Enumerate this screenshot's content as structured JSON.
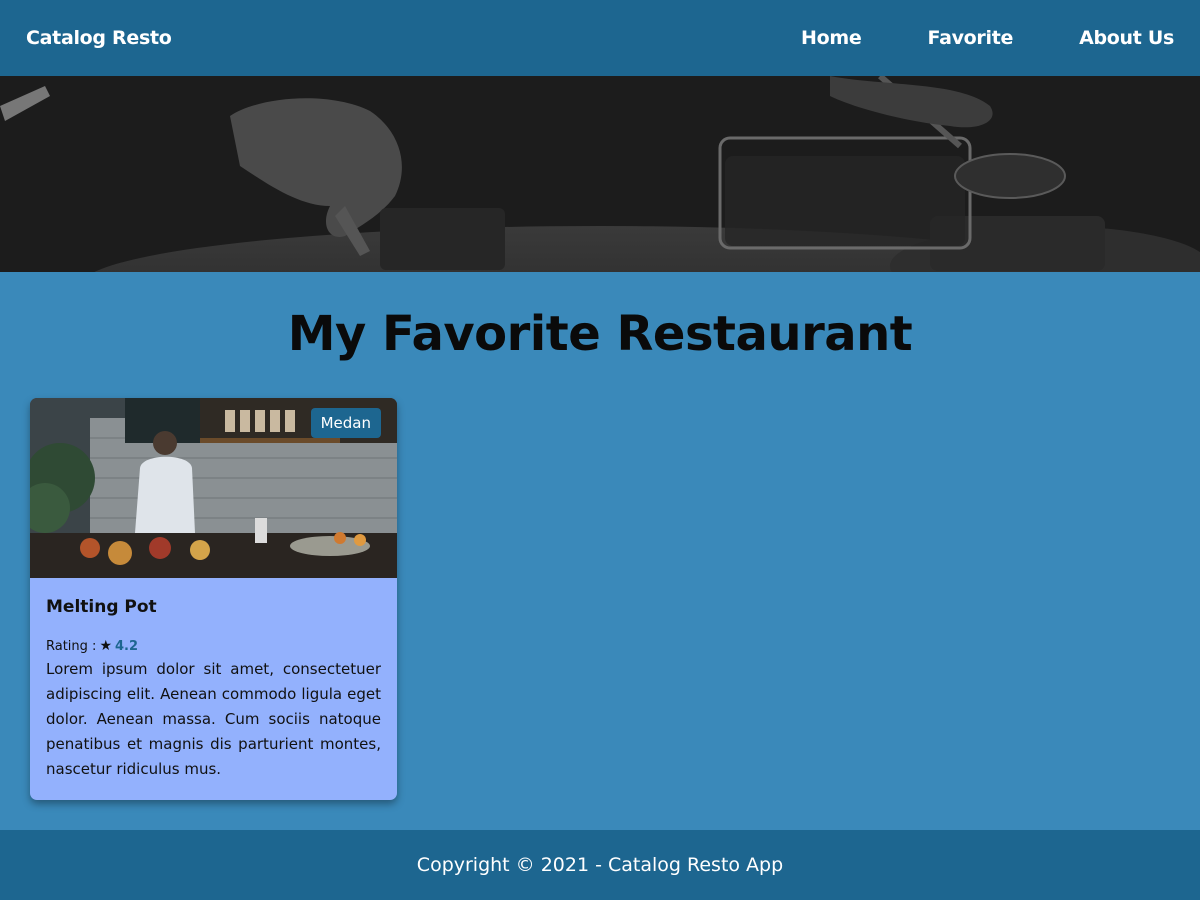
{
  "header": {
    "brand": "Catalog Resto",
    "nav": [
      {
        "label": "Home"
      },
      {
        "label": "Favorite"
      },
      {
        "label": "About Us"
      }
    ]
  },
  "main": {
    "title": "My Favorite Restaurant",
    "restaurants": [
      {
        "city": "Medan",
        "name": "Melting Pot",
        "rating_label": "Rating :",
        "rating_icon": "star-icon",
        "rating": "4.2",
        "description": "Lorem ipsum dolor sit amet, consectetuer adipiscing elit. Aenean commodo ligula eget dolor. Aenean massa. Cum sociis natoque penatibus et magnis dis parturient montes, nascetur ridiculus mus."
      }
    ]
  },
  "footer": {
    "copyright": "Copyright © 2021 - Catalog Resto App"
  },
  "colors": {
    "primary": "#1d6690",
    "background": "#3a89ba",
    "card": "#93b1fd"
  }
}
